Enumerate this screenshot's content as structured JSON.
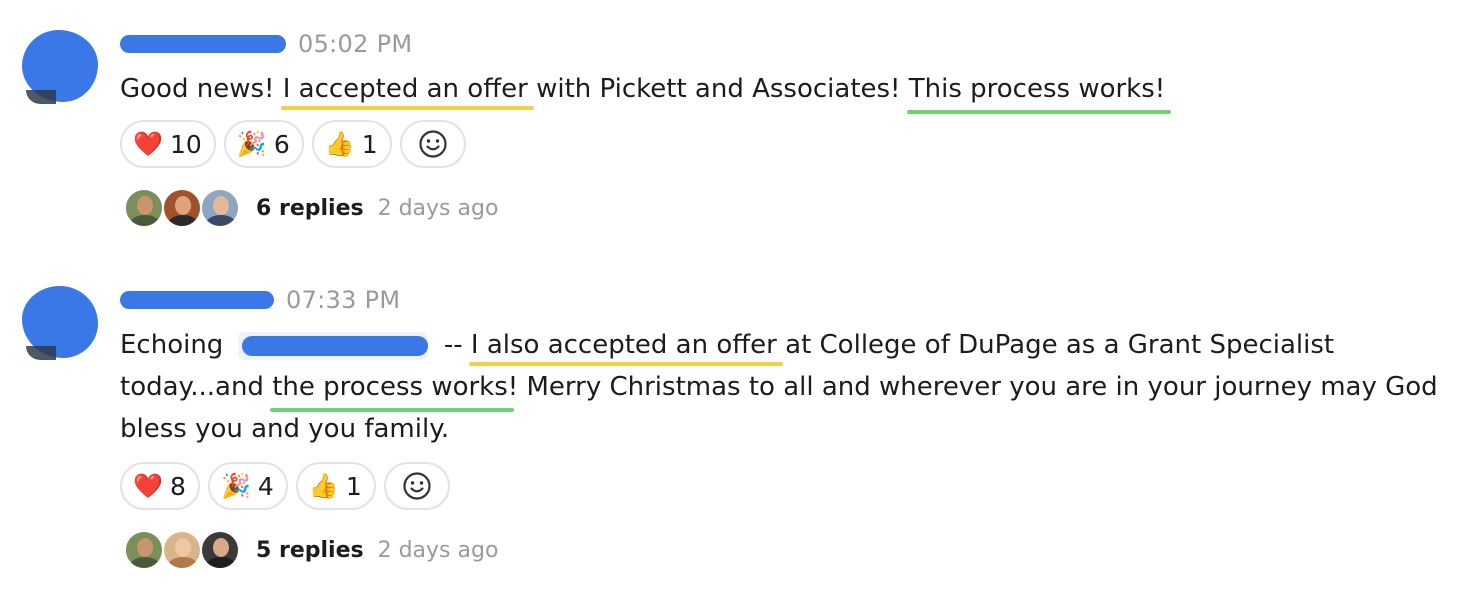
{
  "messages": [
    {
      "time": "05:02 PM",
      "text": {
        "part1": "Good news! ",
        "hl_offer": "I accepted an offer",
        "part2": " with Pickett and Associates! ",
        "hl_process": "This process works!"
      },
      "reactions": [
        {
          "emoji": "❤️",
          "icon": "red-heart-icon",
          "count": "10"
        },
        {
          "emoji": "🎉",
          "icon": "party-popper-icon",
          "count": "6"
        },
        {
          "emoji": "👍",
          "icon": "thumbs-up-icon",
          "count": "1"
        }
      ],
      "add_reaction_icon": "☺",
      "replies": "6 replies",
      "last_reply": "2 days ago"
    },
    {
      "time": "07:33 PM",
      "text": {
        "part1": "Echoing ",
        "sep": " -- ",
        "hl_offer": "I also accepted an offer",
        "part2": " at College of DuPage as a Grant Specialist",
        "part3": "today...and ",
        "hl_process": "the process works",
        "part4": "! Merry Christmas to all and wherever you are in your journey may God",
        "part5": "bless you and you family."
      },
      "reactions": [
        {
          "emoji": "❤️",
          "icon": "red-heart-icon",
          "count": "8"
        },
        {
          "emoji": "🎉",
          "icon": "party-popper-icon",
          "count": "4"
        },
        {
          "emoji": "👍",
          "icon": "thumbs-up-icon",
          "count": "1"
        }
      ],
      "add_reaction_icon": "☺",
      "replies": "5 replies",
      "last_reply": "2 days ago"
    }
  ],
  "colors": {
    "redaction": "#3b78e7",
    "highlight_yellow": "#f5cf48",
    "highlight_green": "#6fd36f",
    "timestamp": "#9a9a9a"
  }
}
